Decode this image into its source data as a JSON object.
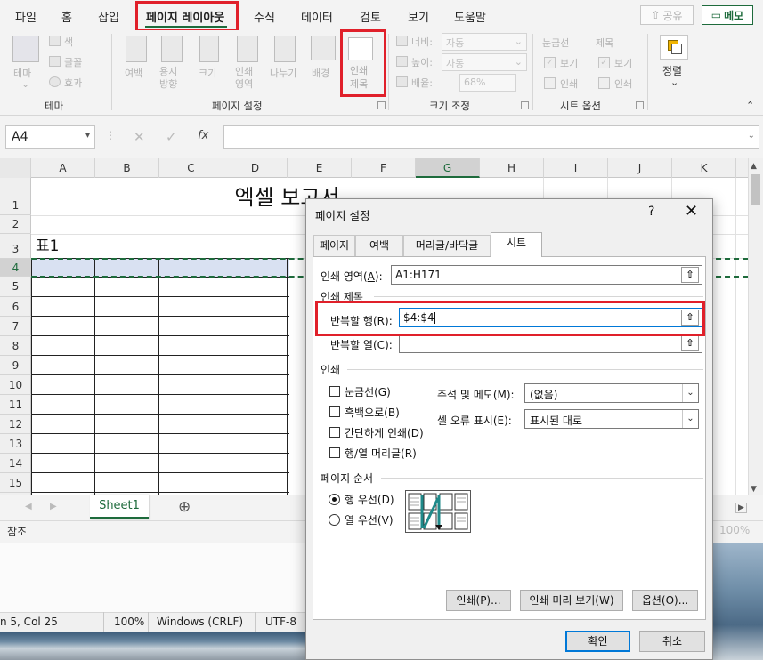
{
  "ribbon_tabs": [
    "파일",
    "홈",
    "삽입",
    "페이지 레이아웃",
    "수식",
    "데이터",
    "검토",
    "보기",
    "도움말"
  ],
  "active_tab": "페이지 레이아웃",
  "share_label": "공유",
  "memo_label": "메모",
  "ribbon": {
    "theme_group": {
      "name": "테마",
      "theme_btn": "테마",
      "colors": "색",
      "fonts": "글꼴",
      "effects": "효과"
    },
    "page_setup_group": {
      "name": "페이지 설정",
      "margins": "여백",
      "orientation": "용지\n방향",
      "size": "크기",
      "print_area": "인쇄\n영역",
      "breaks": "나누기",
      "background": "배경",
      "print_titles": "인쇄\n제목"
    },
    "scale_group": {
      "name": "크기 조정",
      "width_label": "너비:",
      "width_value": "자동",
      "height_label": "높이:",
      "height_value": "자동",
      "scale_label": "배율:",
      "scale_value": "68%"
    },
    "sheet_options_group": {
      "name": "시트 옵션",
      "gridlines": "눈금선",
      "headings": "제목",
      "view": "보기",
      "print": "인쇄"
    },
    "arrange_group": {
      "name": "정렬"
    }
  },
  "name_box": "A4",
  "formula_value": "",
  "columns": [
    "A",
    "B",
    "C",
    "D",
    "E",
    "F",
    "G",
    "H",
    "I",
    "J",
    "K"
  ],
  "rows": [
    "1",
    "2",
    "3",
    "4",
    "5",
    "6",
    "7",
    "8",
    "9",
    "10",
    "11",
    "12",
    "13",
    "14",
    "15"
  ],
  "cells": {
    "title": "엑셀 보고서",
    "table_label": "표1"
  },
  "sheet_tab": "Sheet1",
  "status_text": "참조",
  "zoom": "100%",
  "notepad_status": {
    "position": "n 5, Col 25",
    "zoom": "100%",
    "eol": "Windows (CRLF)",
    "encoding": "UTF-8"
  },
  "dialog": {
    "title": "페이지 설정",
    "help": "?",
    "tabs": [
      "페이지",
      "여백",
      "머리글/바닥글",
      "시트"
    ],
    "active_tab": "시트",
    "print_area_label": "인쇄 영역",
    "print_area_key": "A",
    "print_area_value": "A1:H171",
    "print_titles_section": "인쇄 제목",
    "rows_repeat_label": "반복할 행",
    "rows_repeat_key": "R",
    "rows_repeat_value": "$4:$4",
    "cols_repeat_label": "반복할 열",
    "cols_repeat_key": "C",
    "cols_repeat_value": "",
    "print_section": "인쇄",
    "gridlines": "눈금선(G)",
    "black_white": "흑백으로(B)",
    "draft": "간단하게 인쇄(D)",
    "row_col_headings": "행/열 머리글(R)",
    "comments_label": "주석 및 메모(M):",
    "comments_value": "(없음)",
    "errors_label": "셀 오류 표시(E):",
    "errors_value": "표시된 대로",
    "page_order_section": "페이지 순서",
    "down_then_over": "행 우선(D)",
    "over_then_down": "열 우선(V)",
    "print_btn": "인쇄(P)...",
    "preview_btn": "인쇄 미리 보기(W)",
    "options_btn": "옵션(O)...",
    "ok_btn": "확인",
    "cancel_btn": "취소"
  },
  "colors": {
    "accent": "#1e6b3c",
    "highlight": "#e0202a",
    "selection": "#d9e1f2"
  }
}
